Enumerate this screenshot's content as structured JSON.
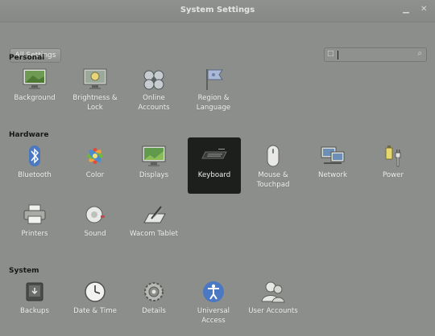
{
  "window": {
    "title": "System Settings",
    "minimize_icon": "minimize-icon",
    "close_icon": "close-icon"
  },
  "toolbar": {
    "all_settings_label": "All Settings",
    "search": {
      "placeholder": "",
      "leading_icon": "search-box-icon",
      "trailing_icon": "search-icon"
    }
  },
  "sections": {
    "personal": {
      "title": "Personal",
      "items": [
        {
          "label": "Background",
          "icon": "background-icon"
        },
        {
          "label": "Brightness & Lock",
          "icon": "brightness-lock-icon"
        },
        {
          "label": "Online Accounts",
          "icon": "online-accounts-icon"
        },
        {
          "label": "Region & Language",
          "icon": "region-language-icon"
        }
      ]
    },
    "hardware": {
      "title": "Hardware",
      "items": [
        {
          "label": "Bluetooth",
          "icon": "bluetooth-icon"
        },
        {
          "label": "Color",
          "icon": "color-icon"
        },
        {
          "label": "Displays",
          "icon": "displays-icon"
        },
        {
          "label": "Keyboard",
          "icon": "keyboard-icon",
          "selected": true
        },
        {
          "label": "Mouse & Touchpad",
          "icon": "mouse-icon"
        },
        {
          "label": "Network",
          "icon": "network-icon"
        },
        {
          "label": "Power",
          "icon": "power-icon"
        },
        {
          "label": "Printers",
          "icon": "printer-icon"
        },
        {
          "label": "Sound",
          "icon": "sound-icon"
        },
        {
          "label": "Wacom Tablet",
          "icon": "wacom-tablet-icon"
        }
      ]
    },
    "system": {
      "title": "System",
      "items": [
        {
          "label": "Backups",
          "icon": "backups-icon"
        },
        {
          "label": "Date & Time",
          "icon": "clock-icon"
        },
        {
          "label": "Details",
          "icon": "details-gear-icon"
        },
        {
          "label": "Universal Access",
          "icon": "universal-access-icon"
        },
        {
          "label": "User Accounts",
          "icon": "user-accounts-icon"
        }
      ]
    }
  },
  "colors": {
    "background": "#8c8e8b",
    "selected_tile": "#1d1f1d"
  }
}
